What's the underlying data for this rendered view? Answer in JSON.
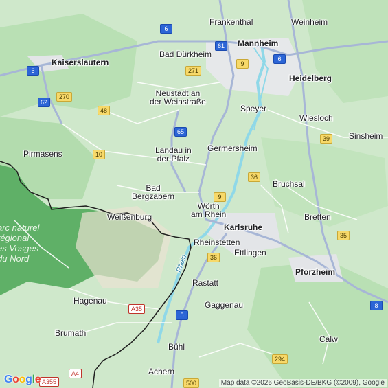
{
  "cities": [
    {
      "id": "frankenthal",
      "name": "Frankenthal"
    },
    {
      "id": "weinheim",
      "name": "Weinheim"
    },
    {
      "id": "mannheim",
      "name": "Mannheim"
    },
    {
      "id": "bad-durkheim",
      "name": "Bad Dürkheim"
    },
    {
      "id": "kaiserslautern",
      "name": "Kaiserslautern"
    },
    {
      "id": "heidelberg",
      "name": "Heidelberg"
    },
    {
      "id": "neustadt",
      "name": "Neustadt an\nder Weinstraße"
    },
    {
      "id": "speyer",
      "name": "Speyer"
    },
    {
      "id": "wiesloch",
      "name": "Wiesloch"
    },
    {
      "id": "sinsheim",
      "name": "Sinsheim"
    },
    {
      "id": "germersheim",
      "name": "Germersheim"
    },
    {
      "id": "pirmasens",
      "name": "Pirmasens"
    },
    {
      "id": "landau",
      "name": "Landau in\nder Pfalz"
    },
    {
      "id": "bruchsal",
      "name": "Bruchsal"
    },
    {
      "id": "bad-bergzabern",
      "name": "Bad\nBergzabern"
    },
    {
      "id": "worth",
      "name": "Wörth\nam Rhein"
    },
    {
      "id": "bretten",
      "name": "Bretten"
    },
    {
      "id": "weissenburg",
      "name": "Weißenburg"
    },
    {
      "id": "karlsruhe",
      "name": "Karlsruhe"
    },
    {
      "id": "rheinstetten",
      "name": "Rheinstetten"
    },
    {
      "id": "ettlingen",
      "name": "Ettlingen"
    },
    {
      "id": "pforzheim",
      "name": "Pforzheim"
    },
    {
      "id": "rastatt",
      "name": "Rastatt"
    },
    {
      "id": "hagenau",
      "name": "Hagenau"
    },
    {
      "id": "gaggenau",
      "name": "Gaggenau"
    },
    {
      "id": "brumath",
      "name": "Brumath"
    },
    {
      "id": "calw",
      "name": "Calw"
    },
    {
      "id": "buhl",
      "name": "Bühl"
    },
    {
      "id": "achern",
      "name": "Achern"
    }
  ],
  "park": {
    "name": "arc naturel\nrégional\nes Vosges\ndu Nord"
  },
  "river": {
    "name": "Rhein"
  },
  "shields": [
    {
      "id": "a6-north",
      "label": "6",
      "style": "blue"
    },
    {
      "id": "a61",
      "label": "61",
      "style": "blue"
    },
    {
      "id": "a6-east",
      "label": "6",
      "style": "blue"
    },
    {
      "id": "a6-west",
      "label": "6",
      "style": "blue"
    },
    {
      "id": "a9-north",
      "label": "9",
      "style": "yellow"
    },
    {
      "id": "b271",
      "label": "271",
      "style": "yellow"
    },
    {
      "id": "a62",
      "label": "62",
      "style": "blue"
    },
    {
      "id": "b270",
      "label": "270",
      "style": "yellow"
    },
    {
      "id": "b48",
      "label": "48",
      "style": "yellow"
    },
    {
      "id": "a65",
      "label": "65",
      "style": "blue"
    },
    {
      "id": "b39",
      "label": "39",
      "style": "yellow"
    },
    {
      "id": "b10",
      "label": "10",
      "style": "yellow"
    },
    {
      "id": "b36-north",
      "label": "36",
      "style": "yellow"
    },
    {
      "id": "b9",
      "label": "9",
      "style": "yellow"
    },
    {
      "id": "b35",
      "label": "35",
      "style": "yellow"
    },
    {
      "id": "b36-south",
      "label": "36",
      "style": "yellow"
    },
    {
      "id": "a35",
      "label": "A35",
      "style": "red"
    },
    {
      "id": "a8",
      "label": "8",
      "style": "blue"
    },
    {
      "id": "a5",
      "label": "5",
      "style": "blue"
    },
    {
      "id": "b294",
      "label": "294",
      "style": "yellow"
    },
    {
      "id": "a4",
      "label": "A4",
      "style": "red"
    },
    {
      "id": "b500",
      "label": "500",
      "style": "yellow"
    },
    {
      "id": "a355",
      "label": "A355",
      "style": "red"
    }
  ],
  "attribution": "Map data ©2026 GeoBasis-DE/BKG (©2009), Google",
  "logo": "Google",
  "colors": {
    "forest": "#a9d8a5",
    "land": "#d5ead2",
    "urban": "#e8e9ec",
    "park": "#3f9a4c",
    "water": "#8fd8e8",
    "border": "#1f1f1f",
    "road": "#ffffff",
    "major_road": "#a7b6d6"
  }
}
